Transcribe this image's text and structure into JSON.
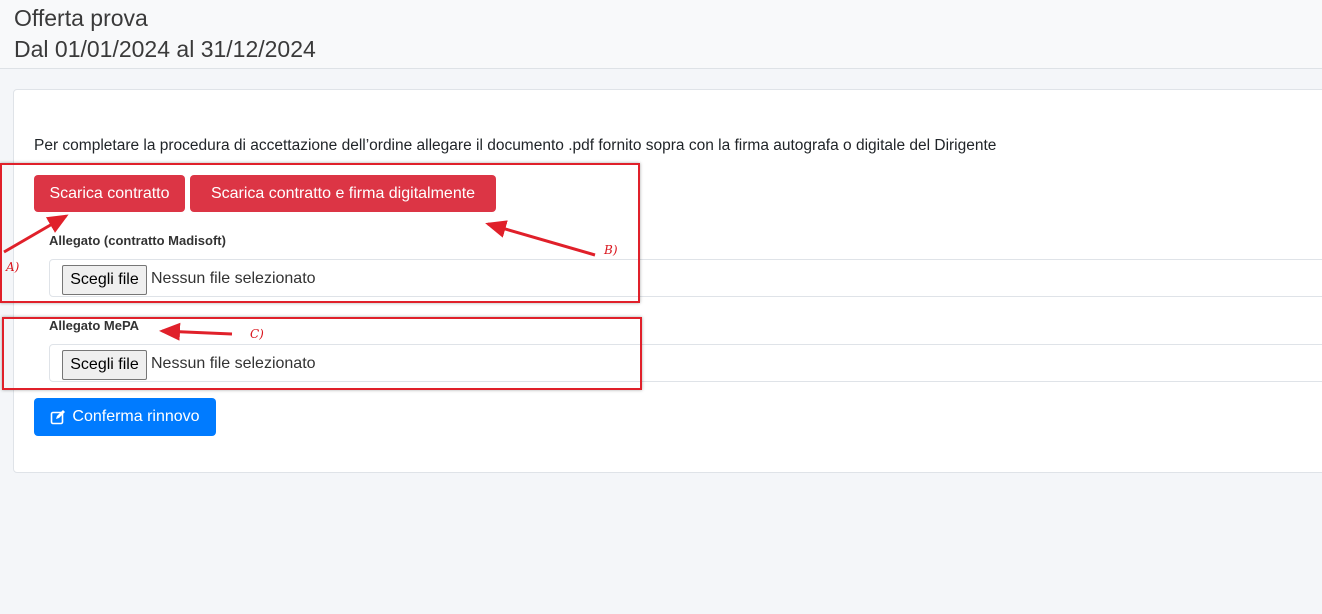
{
  "header": {
    "title": "Offerta prova",
    "period": "Dal 01/01/2024 al 31/12/2024"
  },
  "card": {
    "instructions": "Per completare la procedura di accettazione dell’ordine allegare il documento .pdf fornito sopra con la firma autografa o digitale del Dirigente",
    "buttons": {
      "download": "Scarica contratto",
      "download_sign": "Scarica contratto e firma digitalmente",
      "confirm": "Conferma rinnovo",
      "confirm_icon": "edit-icon"
    },
    "attachments": [
      {
        "label": "Allegato (contratto Madisoft)",
        "button": "Scegli file",
        "status": "Nessun file selezionato"
      },
      {
        "label": "Allegato MePA",
        "button": "Scegli file",
        "status": "Nessun file selezionato"
      }
    ]
  },
  "annotations": {
    "a": "A)",
    "b": "B)",
    "c": "C)",
    "color": "#e0202a"
  },
  "colors": {
    "danger": "#dc3545",
    "primary": "#007bff"
  }
}
